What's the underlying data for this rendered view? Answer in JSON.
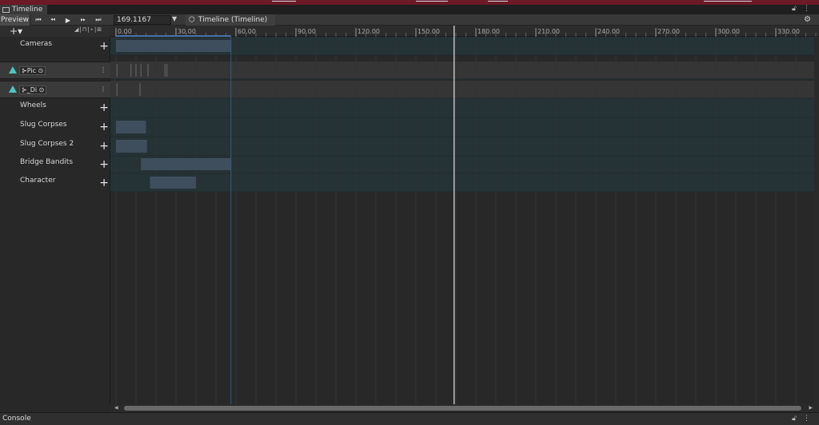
{
  "window": {
    "tab_label": "Timeline",
    "lock_icon": "lock-icon",
    "menu_icon": "kebab-menu-icon"
  },
  "toolbar": {
    "preview_label": "Preview",
    "buttons": [
      "goto-start-icon",
      "prev-frame-icon",
      "play-icon",
      "next-frame-icon",
      "goto-end-icon"
    ],
    "current_time": "169.1167",
    "asset_label": "Timeline (Timeline)"
  },
  "tracks": [
    {
      "kind": "group",
      "label": "Cameras"
    },
    {
      "kind": "sub",
      "label": "⊱Pic"
    },
    {
      "kind": "sub",
      "label": "⊱_Di"
    },
    {
      "kind": "group",
      "label": "Wheels"
    },
    {
      "kind": "group",
      "label": "Slug Corpses"
    },
    {
      "kind": "group",
      "label": "Slug Corpses 2"
    },
    {
      "kind": "group",
      "label": "Bridge Bandits"
    },
    {
      "kind": "group",
      "label": "Character"
    }
  ],
  "ruler": {
    "labels": [
      "0.00",
      "30.00",
      "60.00",
      "90.00",
      "120.00",
      "150.00",
      "180.00",
      "210.00",
      "240.00",
      "270.00",
      "300.00",
      "330.00"
    ],
    "start": 0,
    "step": 30
  },
  "playhead_time": 169.1167,
  "clips": [
    {
      "track": 0,
      "start": 0,
      "end": 57.5
    },
    {
      "track": 4,
      "start": 0,
      "end": 15
    },
    {
      "track": 5,
      "start": 0,
      "end": 15.5
    },
    {
      "track": 6,
      "start": 12.5,
      "end": 57.5
    },
    {
      "track": 7,
      "start": 17,
      "end": 40
    }
  ],
  "markers": {
    "track": 1,
    "times": [
      0.5,
      7.5,
      10,
      12.5,
      16,
      24.5,
      25.5
    ],
    "track2": 2,
    "times2": [
      0.5,
      12
    ]
  },
  "colors": {
    "accent_cyan": "#4fc3c8",
    "clip": "#3f4e5c",
    "track_bg": "#253236",
    "playhead": "#e6e6e6"
  },
  "console_label": "Console"
}
